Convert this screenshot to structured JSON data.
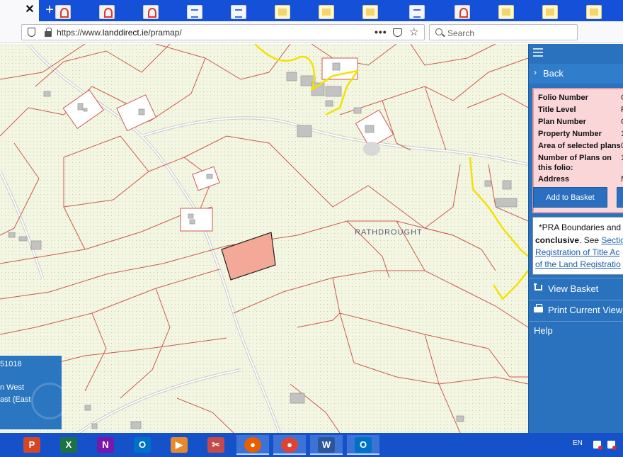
{
  "browser": {
    "tab_close_glyph": "✕",
    "new_tab_glyph": "+",
    "url_prefix": "https://www.",
    "url_host": "landdirect.ie",
    "url_path": "/pramap/",
    "url_more": "•••",
    "search_placeholder": "Search"
  },
  "map": {
    "townland_label": "RATHDROUGHT"
  },
  "info_panel": {
    "line1": "51018",
    "line2": "n West",
    "line3": "ast (East"
  },
  "sidebar": {
    "back_label": "Back",
    "folio": {
      "rows": [
        {
          "label": "Folio Number",
          "value": "C"
        },
        {
          "label": "Title Level",
          "value": "F"
        },
        {
          "label": "Plan Number",
          "value": "C"
        },
        {
          "label": "Property Number",
          "value": "1"
        },
        {
          "label": "Area of selected plans",
          "value": "0"
        },
        {
          "label": "Number of Plans on",
          "label2": "this folio:",
          "value": "1"
        },
        {
          "label": "Address",
          "value": "N"
        }
      ],
      "add_to_basket_label": "Add to Basket"
    },
    "notice": {
      "line1": "*PRA Boundaries and Pla",
      "line2_bold": "conclusive",
      "line2_rest": ". See ",
      "line2_link": "Section",
      "line3_link": "Registration of Title Ac",
      "line4_link": "of the Land Registratio"
    },
    "menu": {
      "view_basket": "View Basket",
      "print_view": "Print Current View",
      "help": "Help"
    }
  },
  "taskbar": {
    "apps": [
      {
        "name": "powerpoint",
        "glyph": "P",
        "color": "#d24726"
      },
      {
        "name": "excel",
        "glyph": "X",
        "color": "#1e7145"
      },
      {
        "name": "onenote",
        "glyph": "N",
        "color": "#7719aa"
      },
      {
        "name": "outlook",
        "glyph": "O",
        "color": "#0072c6"
      },
      {
        "name": "video",
        "glyph": "▶",
        "color": "#e6892d"
      },
      {
        "name": "snipping",
        "glyph": "✂",
        "color": "#c54a4a"
      },
      {
        "name": "firefox",
        "glyph": "●",
        "color": "#e66000"
      },
      {
        "name": "chrome",
        "glyph": "●",
        "color": "#db4437"
      },
      {
        "name": "word",
        "glyph": "W",
        "color": "#2b579a"
      },
      {
        "name": "outlook-2",
        "glyph": "O",
        "color": "#0072c6"
      }
    ],
    "language": "EN"
  },
  "colors": {
    "panel_blue": "#2a72bd",
    "folio_pink": "#fbd6d9",
    "selected_parcel": "#f4a898",
    "boundary_red": "#cc5a4c",
    "road_yellow": "#f2e200"
  }
}
